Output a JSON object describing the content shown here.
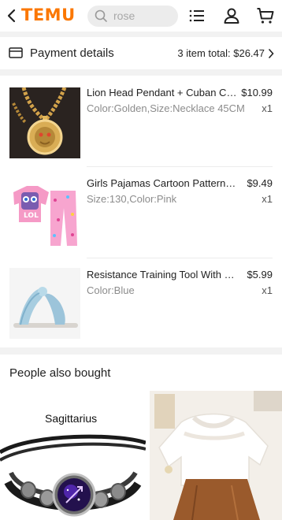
{
  "header": {
    "logo": "TEMU",
    "search_placeholder": "rose",
    "icons": [
      "back-chevron-icon",
      "search-icon",
      "menu-list-icon",
      "account-icon",
      "cart-icon"
    ]
  },
  "payment": {
    "title": "Payment details",
    "total": "3 item total: $26.47"
  },
  "items": [
    {
      "name": "Lion Head Pendant + Cuban Chain Necklace",
      "price": "$10.99",
      "spec": "Color:Golden,Size:Necklace 45CM",
      "qty": "x1"
    },
    {
      "name": "Girls Pajamas Cartoon Pattern Set",
      "price": "$9.49",
      "spec": "Size:130,Color:Pink",
      "qty": "x1"
    },
    {
      "name": "Resistance Training Tool With Soft Grip",
      "price": "$5.99",
      "spec": "Color:Blue",
      "qty": "x1"
    }
  ],
  "also_bought": {
    "title": "People also bought",
    "products": [
      {
        "caption": "Sagittarius"
      },
      {
        "caption": ""
      }
    ]
  },
  "colors": {
    "brand": "#fb7701",
    "secondary_text": "#8c8c8c",
    "background": "#f2f2f2"
  }
}
